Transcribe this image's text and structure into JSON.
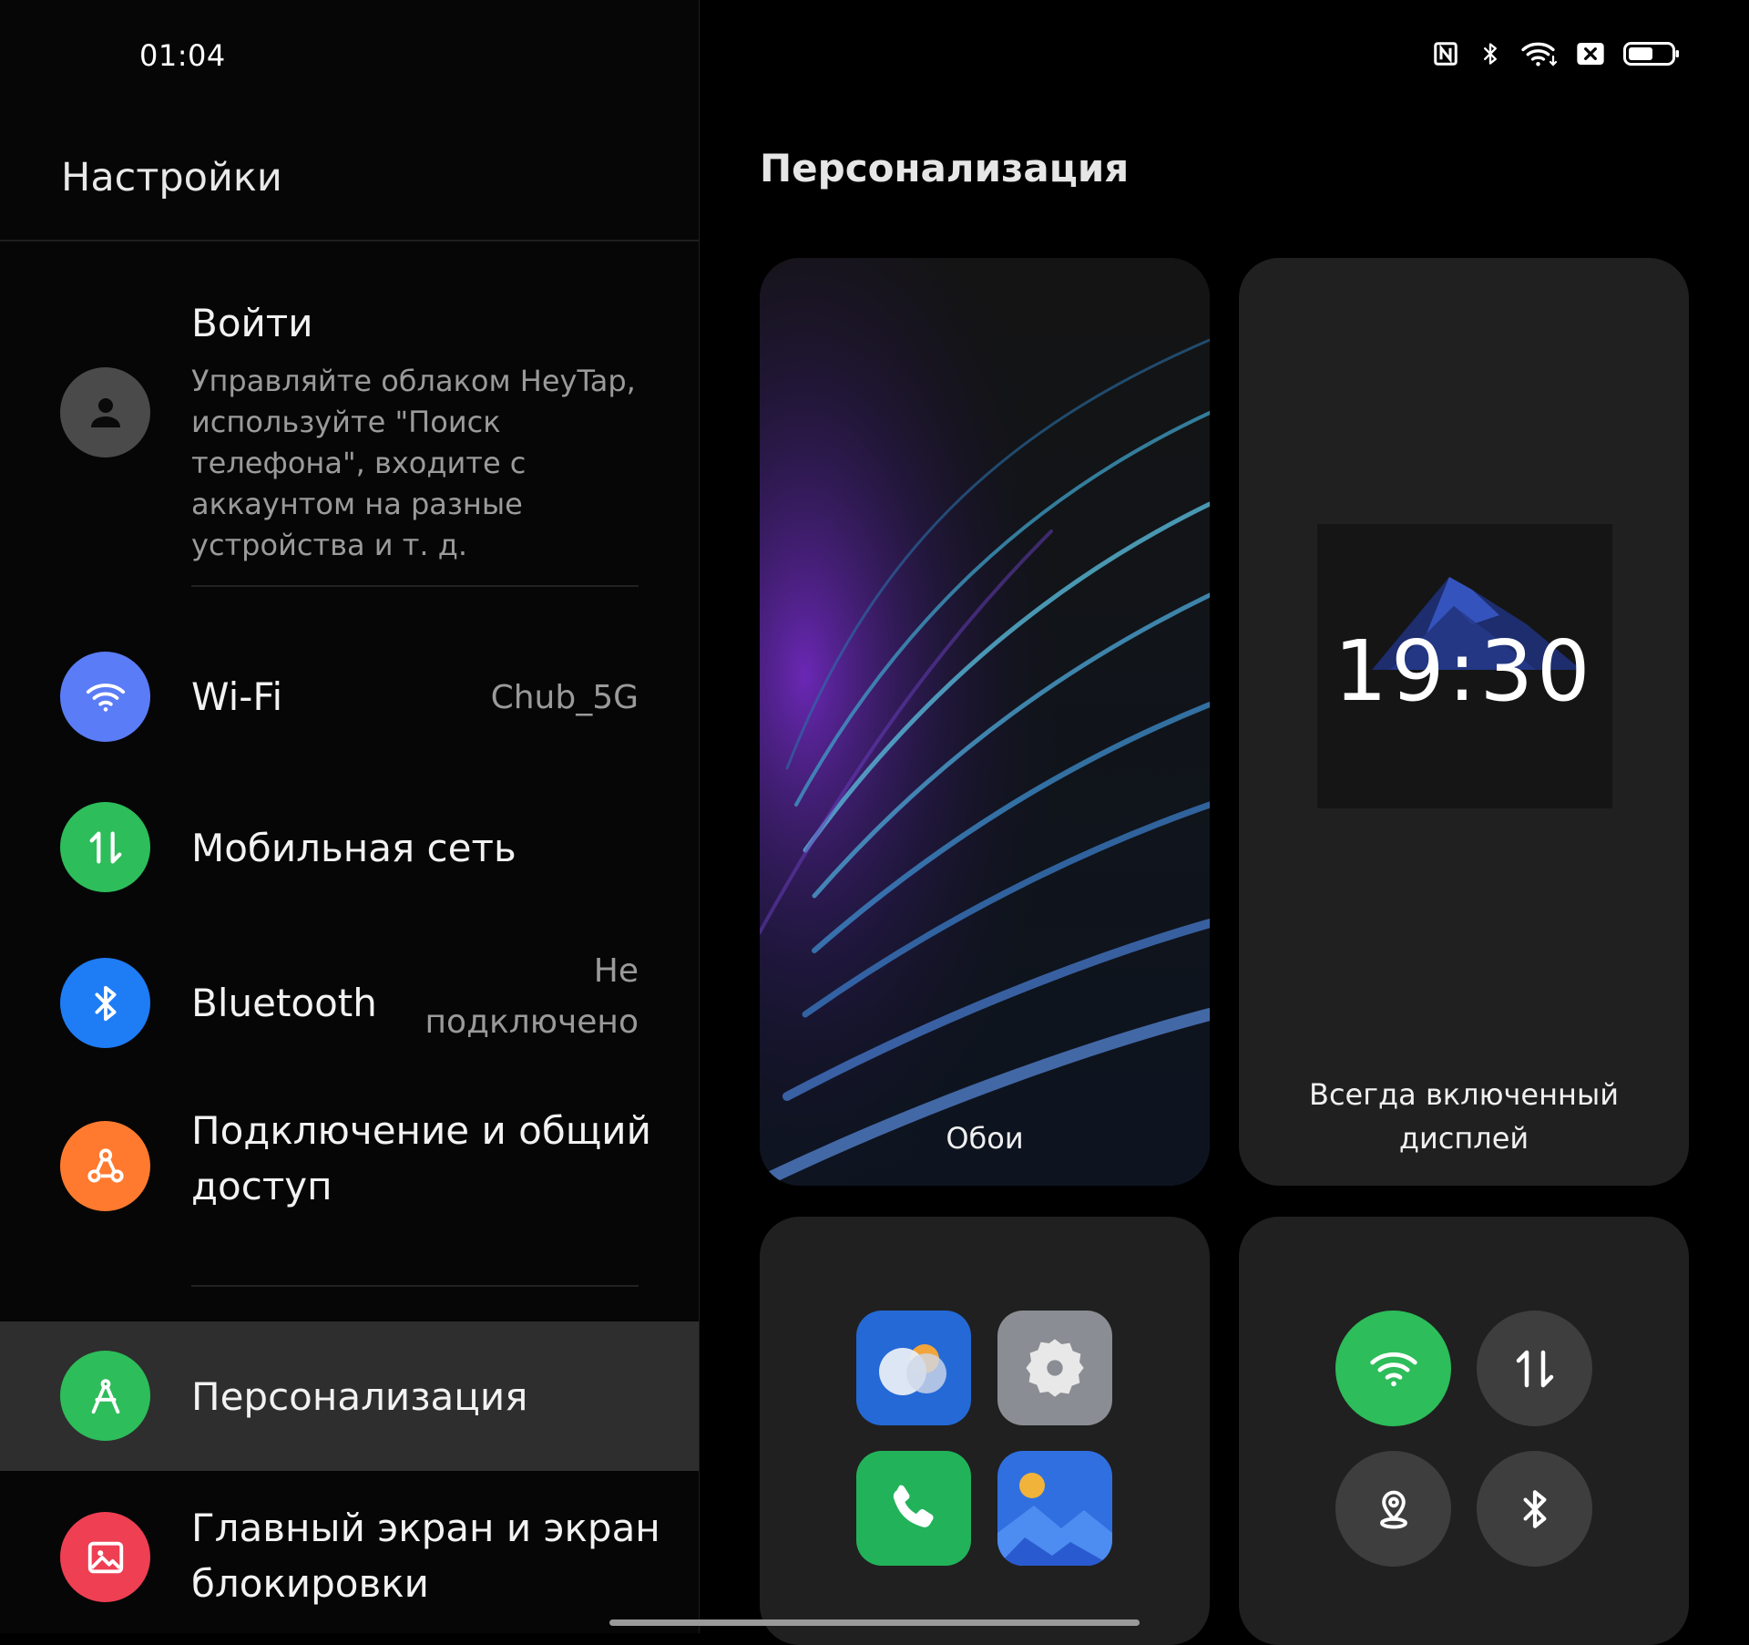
{
  "status_bar": {
    "time": "01:04",
    "icons": [
      "nfc-icon",
      "bluetooth-icon",
      "wifi-icon",
      "no-sim-icon",
      "battery-icon"
    ]
  },
  "left": {
    "title": "Настройки",
    "account": {
      "title": "Войти",
      "description": "Управляйте облаком HeyTap, используйте \"Поиск телефона\", входите с аккаунтом на разные устройства и т. д."
    },
    "items": [
      {
        "label": "Wi-Fi",
        "value": "Chub_5G",
        "icon": "wifi-icon",
        "color": "#5a7cf6"
      },
      {
        "label": "Мобильная сеть",
        "value": "",
        "icon": "mobile-data-icon",
        "color": "#2dbd5a"
      },
      {
        "label": "Bluetooth",
        "value_line1": "Не",
        "value_line2": "подключено",
        "icon": "bluetooth-icon",
        "color": "#1e7cf5"
      },
      {
        "label_line1": "Подключение и общий",
        "label_line2": "доступ",
        "icon": "connection-share-icon",
        "color": "#ff7a2f"
      },
      {
        "label": "Персонализация",
        "icon": "personalization-icon",
        "color": "#2dbd5a",
        "selected": true
      },
      {
        "label_line1": "Главный экран и экран",
        "label_line2": "блокировки",
        "icon": "home-lock-screen-icon",
        "color": "#ee3f53"
      }
    ]
  },
  "right": {
    "title": "Персонализация",
    "cards": {
      "wallpaper": {
        "label": "Обои"
      },
      "aod": {
        "label_line1": "Всегда включенный",
        "label_line2": "дисплей",
        "clock": "19:30"
      }
    }
  }
}
